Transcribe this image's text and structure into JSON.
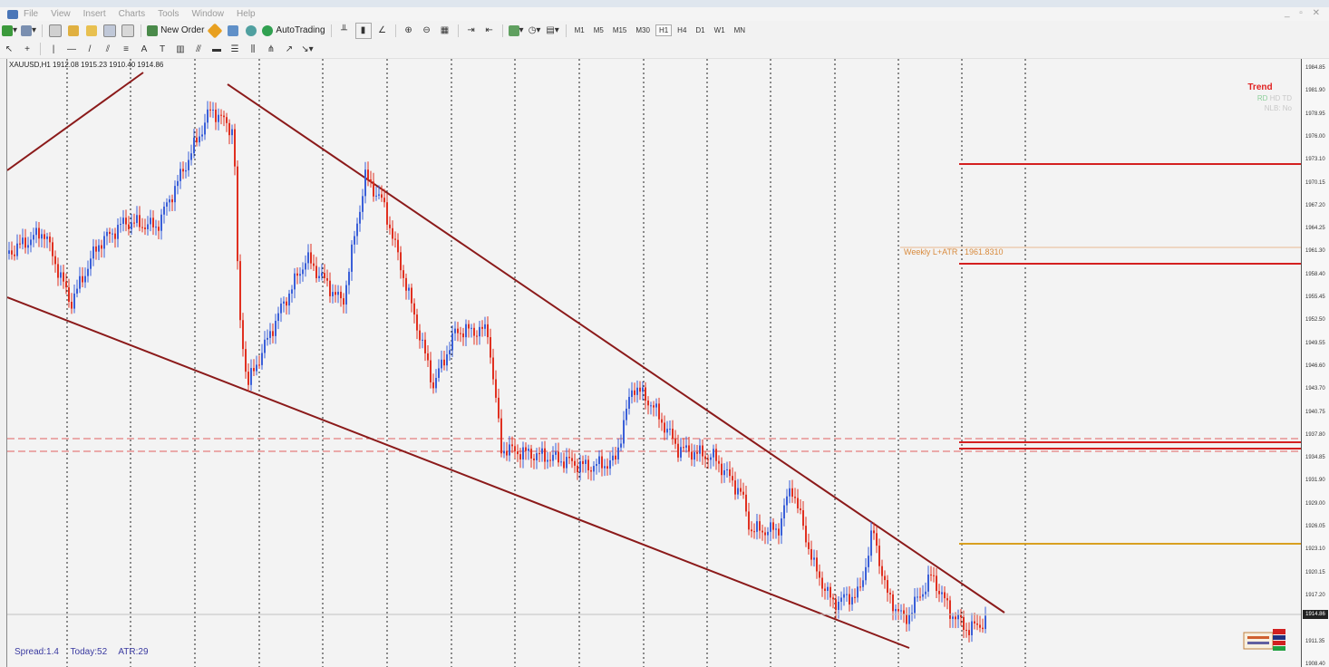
{
  "menu": [
    "File",
    "View",
    "Insert",
    "Charts",
    "Tools",
    "Window",
    "Help"
  ],
  "toolbar": {
    "new_order_label": "New Order",
    "autotrading_label": "AutoTrading",
    "timeframes": [
      "M1",
      "M5",
      "M15",
      "M30",
      "H1",
      "H4",
      "D1",
      "W1",
      "MN"
    ],
    "active_timeframe": "H1"
  },
  "chart": {
    "header": "XAUUSD,H1  1912.08 1915.23 1910.40 1914.86",
    "weekly_label": "Weekly L+ATR : 1961.8310",
    "trend": {
      "title": "Trend",
      "row1": [
        "RD",
        "HD",
        "TD"
      ],
      "row2": "NLB: No"
    },
    "status": {
      "spread": "Spread:1.4",
      "today": "Today:52",
      "atr": "ATR:29"
    },
    "current_price": "1914.86",
    "price_levels": [
      "1984.85",
      "1981.90",
      "1978.95",
      "1976.00",
      "1973.10",
      "1970.15",
      "1967.20",
      "1964.25",
      "1961.30",
      "1958.40",
      "1955.45",
      "1952.50",
      "1949.55",
      "1946.60",
      "1943.70",
      "1940.75",
      "1937.80",
      "1934.85",
      "1931.90",
      "1929.00",
      "1926.05",
      "1923.10",
      "1920.15",
      "1917.20",
      "1914.30",
      "1911.35",
      "1908.40"
    ],
    "colors": {
      "trendline": "#8b1a1a",
      "bull": "#3a5fd8",
      "bear": "#e03020",
      "level_red": "#d42020",
      "level_orange": "#d8a020"
    }
  }
}
